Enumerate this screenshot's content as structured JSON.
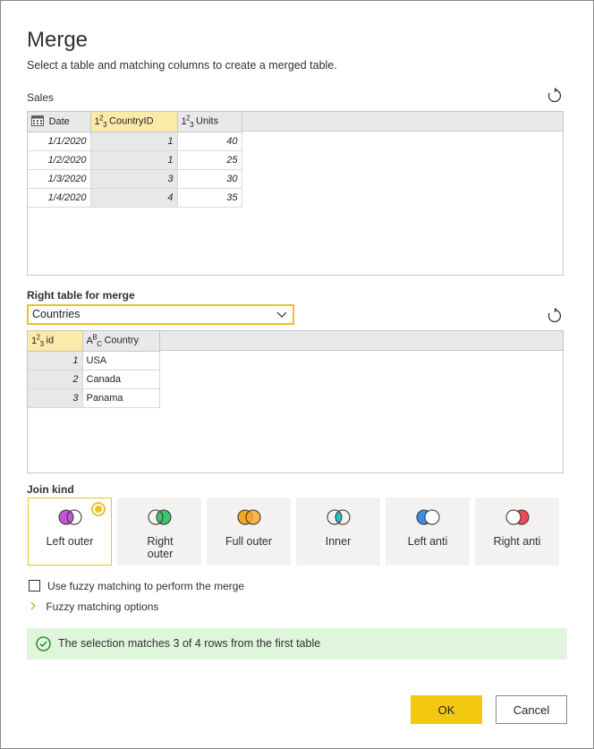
{
  "dialog": {
    "title": "Merge",
    "subtitle": "Select a table and matching columns to create a merged table."
  },
  "left_table": {
    "name": "Sales",
    "columns": [
      {
        "type_icon": "calendar-icon",
        "name": "Date",
        "selected": false
      },
      {
        "type_icon": "123",
        "name": "CountryID",
        "selected": true
      },
      {
        "type_icon": "123",
        "name": "Units",
        "selected": false
      }
    ],
    "rows": [
      [
        "1/1/2020",
        "1",
        "40"
      ],
      [
        "1/2/2020",
        "1",
        "25"
      ],
      [
        "1/3/2020",
        "3",
        "30"
      ],
      [
        "1/4/2020",
        "4",
        "35"
      ]
    ]
  },
  "right_table": {
    "label": "Right table for merge",
    "selected": "Countries",
    "columns": [
      {
        "type_icon": "123",
        "name": "id",
        "selected": true
      },
      {
        "type_icon": "ABC",
        "name": "Country",
        "selected": false
      }
    ],
    "rows": [
      [
        "1",
        "USA"
      ],
      [
        "2",
        "Canada"
      ],
      [
        "3",
        "Panama"
      ]
    ]
  },
  "join_kind": {
    "label": "Join kind",
    "options": [
      {
        "label": "Left outer",
        "selected": true,
        "color": "#c157d6"
      },
      {
        "label": "Right outer",
        "selected": false,
        "color": "#3ec46d"
      },
      {
        "label": "Full outer",
        "selected": false,
        "color": "#f5a623"
      },
      {
        "label": "Inner",
        "selected": false,
        "color": "#26c0c7"
      },
      {
        "label": "Left anti",
        "selected": false,
        "color": "#3a8ee6"
      },
      {
        "label": "Right anti",
        "selected": false,
        "color": "#f04a5b"
      }
    ]
  },
  "fuzzy": {
    "checkbox_label": "Use fuzzy matching to perform the merge",
    "options_label": "Fuzzy matching options"
  },
  "status": {
    "message": "The selection matches 3 of 4 rows from the first table"
  },
  "buttons": {
    "ok": "OK",
    "cancel": "Cancel"
  },
  "colors": {
    "accent": "#f2c811",
    "selected_header": "#fbeaa8",
    "success_bg": "#dff6dd",
    "success_icon": "#107c10"
  }
}
